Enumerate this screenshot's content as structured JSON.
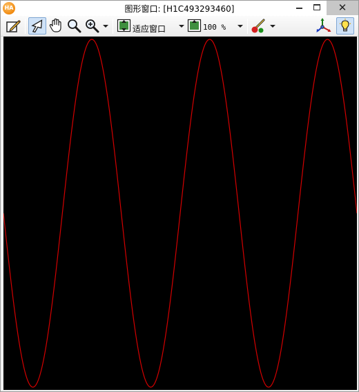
{
  "window": {
    "title": "图形窗口: [H1C493293460]",
    "app_icon_text": "HA",
    "icon": "halcon-app-icon"
  },
  "title_controls": {
    "minimize_icon": "minimize-icon",
    "maximize_icon": "maximize-icon",
    "close_glyph": "✕"
  },
  "toolbar": {
    "edit_icon": "edit-pencil-icon",
    "pointer_icon": "pointer-arrow-icon",
    "pan_icon": "hand-pan-icon",
    "zoom_icon": "magnifier-icon",
    "zoom_in_icon": "magnifier-plus-icon",
    "fit_icon": "fit-window-icon",
    "fit_label": "适应窗口",
    "zoom_percent_icon": "zoom-percent-icon",
    "zoom_percent": "100 %",
    "color_icon": "color-palette-icon",
    "axes_icon": "axes-3d-icon",
    "lightbulb_icon": "lightbulb-icon"
  },
  "graphics": {
    "background": "#000000",
    "curve_color": "#d40000",
    "curve_type": "sine",
    "cycles_visible": 3
  },
  "chart_data": {
    "type": "line",
    "title": "",
    "xlabel": "",
    "ylabel": "",
    "grid": false,
    "series": [
      {
        "x": [
          0,
          0.5,
          1.0,
          1.5,
          2.0,
          2.5,
          3.0
        ],
        "y": [
          0,
          -1,
          0,
          1,
          0,
          -1,
          0
        ]
      }
    ]
  }
}
